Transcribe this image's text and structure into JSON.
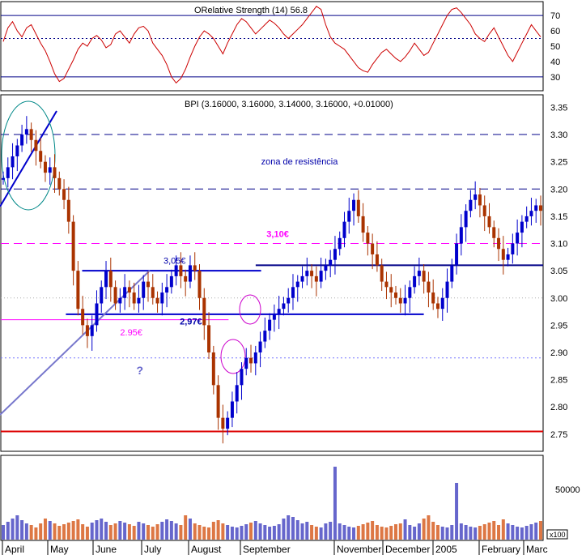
{
  "chart_data": [
    {
      "panel": "rsi",
      "type": "line",
      "title": "ORelative Strength (14) 56.8",
      "yticks": [
        30,
        40,
        50,
        60,
        70
      ],
      "ylim": [
        22,
        78
      ],
      "reference_lines": [
        30,
        55,
        70
      ],
      "series": [
        {
          "color": "#cc0000",
          "values": [
            53,
            62,
            66,
            60,
            56,
            62,
            64,
            58,
            52,
            47,
            40,
            32,
            27,
            29,
            35,
            41,
            48,
            52,
            50,
            55,
            57,
            54,
            49,
            51,
            58,
            60,
            56,
            52,
            58,
            62,
            63,
            60,
            52,
            48,
            44,
            38,
            30,
            26,
            29,
            35,
            43,
            50,
            56,
            60,
            58,
            55,
            50,
            45,
            52,
            58,
            64,
            68,
            66,
            62,
            58,
            61,
            64,
            67,
            65,
            62,
            58,
            55,
            58,
            61,
            64,
            68,
            72,
            76,
            74,
            64,
            56,
            52,
            50,
            48,
            44,
            40,
            36,
            34,
            33,
            38,
            42,
            46,
            48,
            45,
            42,
            40,
            43,
            47,
            52,
            48,
            44,
            46,
            52,
            58,
            64,
            70,
            74,
            75,
            72,
            68,
            64,
            58,
            55,
            53,
            58,
            62,
            56,
            50,
            44,
            40,
            46,
            52,
            58,
            64,
            60,
            56
          ]
        }
      ]
    },
    {
      "panel": "price",
      "type": "bar",
      "title": "BPI (3.16000, 3.16000, 3.14000, 3.16000, +0.01000)",
      "yticks": [
        "3.35",
        "3.30",
        "3.25",
        "3.20",
        "3.15",
        "3.10",
        "3.05",
        "3.00",
        "2.95",
        "2.90",
        "2.85",
        "2.80",
        "2.75"
      ],
      "ylim": [
        2.72,
        3.37
      ],
      "xlabels": [
        "April",
        "May",
        "June",
        "July",
        "August",
        "September",
        "November",
        "December",
        "2005",
        "February",
        "Marc"
      ],
      "close": [
        3.22,
        3.24,
        3.26,
        3.28,
        3.3,
        3.31,
        3.29,
        3.27,
        3.25,
        3.23,
        3.24,
        3.22,
        3.2,
        3.18,
        3.14,
        3.05,
        2.98,
        2.95,
        2.93,
        2.95,
        2.99,
        3.02,
        3.05,
        3.02,
        2.99,
        3.0,
        3.02,
        3.01,
        2.99,
        3.0,
        3.03,
        3.02,
        3.0,
        2.99,
        3.01,
        3.02,
        3.04,
        3.06,
        3.04,
        3.03,
        3.06,
        3.05,
        3.0,
        2.95,
        2.9,
        2.84,
        2.78,
        2.76,
        2.78,
        2.81,
        2.84,
        2.87,
        2.89,
        2.88,
        2.9,
        2.92,
        2.94,
        2.96,
        2.97,
        2.98,
        2.99,
        3.0,
        3.02,
        3.03,
        3.04,
        3.05,
        3.04,
        3.03,
        3.05,
        3.06,
        3.07,
        3.09,
        3.11,
        3.14,
        3.16,
        3.18,
        3.15,
        3.12,
        3.1,
        3.08,
        3.06,
        3.03,
        3.02,
        3.01,
        3.0,
        2.99,
        3.0,
        3.02,
        3.04,
        3.05,
        3.03,
        3.01,
        2.99,
        2.98,
        3.0,
        3.03,
        3.06,
        3.1,
        3.13,
        3.16,
        3.18,
        3.19,
        3.17,
        3.15,
        3.13,
        3.11,
        3.09,
        3.07,
        3.08,
        3.1,
        3.12,
        3.14,
        3.15,
        3.16,
        3.17,
        3.16
      ],
      "hlines": [
        {
          "y": 3.3,
          "style": "dashed",
          "color": "#000088"
        },
        {
          "y": 3.2,
          "style": "dashed",
          "color": "#000088"
        },
        {
          "y": 3.1,
          "style": "dashed",
          "color": "#ff00ff"
        },
        {
          "y": 3.06,
          "style": "solid",
          "color": "#000088",
          "from": 0.47
        },
        {
          "y": 3.05,
          "style": "solid",
          "color": "#0000cc",
          "from": 0.15,
          "to": 0.48
        },
        {
          "y": 2.97,
          "style": "solid",
          "color": "#0000cc",
          "from": 0.12,
          "to": 0.78
        },
        {
          "y": 2.96,
          "style": "solid",
          "color": "#ff00ff",
          "from": 0.0,
          "to": 0.42
        },
        {
          "y": 2.89,
          "style": "dotted",
          "color": "#7777ff"
        },
        {
          "y": 2.755,
          "style": "solid",
          "color": "#dd0000"
        }
      ],
      "annotations": [
        {
          "text": "zona de resistência",
          "y": 3.245,
          "xfrac": 0.48,
          "color": "#0000aa"
        },
        {
          "text": "3,10€",
          "y": 3.112,
          "xfrac": 0.49,
          "color": "#ff00ff",
          "bold": true
        },
        {
          "text": "3,05€",
          "y": 3.063,
          "xfrac": 0.3,
          "color": "#0000aa"
        },
        {
          "text": "2,97€",
          "y": 2.951,
          "xfrac": 0.33,
          "color": "#0000aa",
          "bold": true
        },
        {
          "text": "2.95€",
          "y": 2.931,
          "xfrac": 0.22,
          "color": "#ff00ff"
        },
        {
          "text": "?",
          "y": 2.86,
          "xfrac": 0.25,
          "color": "#6666cc",
          "bold": true
        }
      ]
    },
    {
      "panel": "volume",
      "type": "bar",
      "ytick_labels": [
        "50000"
      ],
      "unit_label": "x100",
      "values": [
        180,
        220,
        260,
        300,
        240,
        200,
        180,
        150,
        200,
        260,
        230,
        200,
        170,
        190,
        210,
        230,
        250,
        190,
        160,
        210,
        240,
        260,
        220,
        180,
        200,
        230,
        210,
        190,
        170,
        220,
        200,
        180,
        160,
        190,
        220,
        250,
        230,
        200,
        180,
        300,
        260,
        200,
        180,
        160,
        150,
        220,
        240,
        200,
        180,
        160,
        150,
        170,
        190,
        210,
        230,
        200,
        180,
        160,
        170,
        190,
        260,
        300,
        280,
        240,
        200,
        220,
        180,
        160,
        150,
        200,
        220,
        900,
        200,
        180,
        160,
        150,
        170,
        190,
        210,
        230,
        180,
        160,
        150,
        170,
        190,
        200,
        250,
        180,
        160,
        200,
        260,
        300,
        220,
        180,
        160,
        150,
        180,
        700,
        200,
        180,
        160,
        150,
        170,
        190,
        210,
        230,
        180,
        250,
        200,
        180,
        160,
        150,
        170,
        190,
        210,
        230
      ]
    }
  ]
}
